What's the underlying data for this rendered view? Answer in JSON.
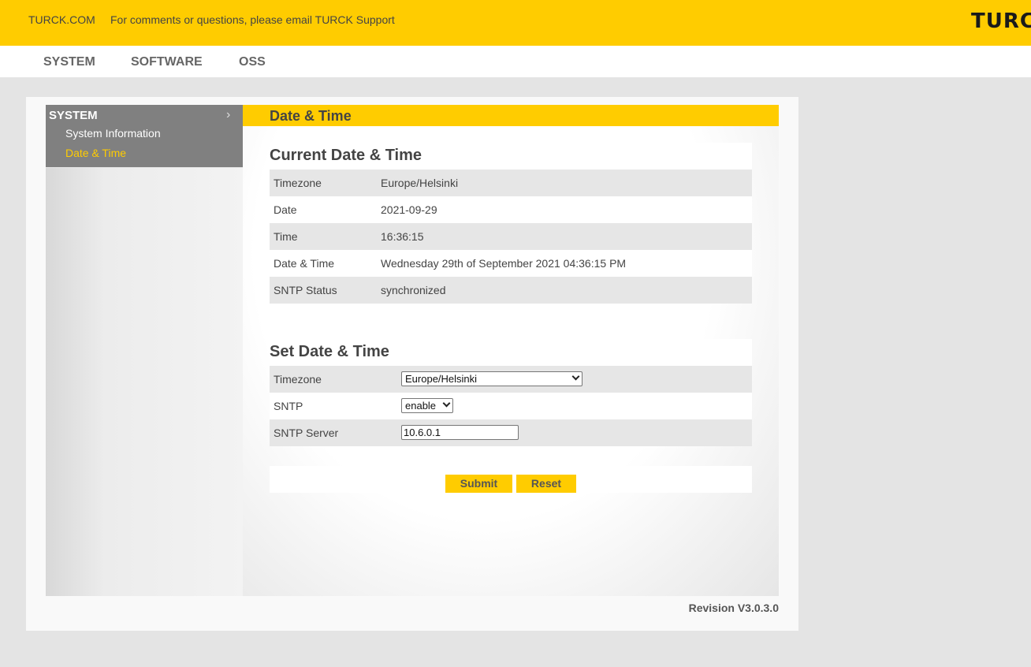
{
  "header": {
    "site_link": "TURCK.COM",
    "support_text": "For comments or questions, please email TURCK Support",
    "logo_text": "TURCK"
  },
  "nav": {
    "items": [
      "SYSTEM",
      "SOFTWARE",
      "OSS"
    ]
  },
  "sidebar": {
    "title": "SYSTEM",
    "chevron": "›",
    "items": [
      {
        "label": "System Information",
        "active": false
      },
      {
        "label": "Date & Time",
        "active": true
      }
    ]
  },
  "content": {
    "title": "Date & Time",
    "current": {
      "title": "Current Date & Time",
      "rows": [
        {
          "label": "Timezone",
          "value": "Europe/Helsinki"
        },
        {
          "label": "Date",
          "value": "2021-09-29"
        },
        {
          "label": "Time",
          "value": "16:36:15"
        },
        {
          "label": "Date & Time",
          "value": "Wednesday 29th of September 2021 04:36:15 PM"
        },
        {
          "label": "SNTP Status",
          "value": "synchronized"
        }
      ]
    },
    "set": {
      "title": "Set Date & Time",
      "timezone_label": "Timezone",
      "timezone_value": "Europe/Helsinki",
      "sntp_label": "SNTP",
      "sntp_value": "enable",
      "server_label": "SNTP Server",
      "server_value": "10.6.0.1"
    },
    "buttons": {
      "submit": "Submit",
      "reset": "Reset"
    }
  },
  "footer": {
    "revision": "Revision V3.0.3.0"
  },
  "colors": {
    "accent": "#ffcc00",
    "sidebar_head": "#808080",
    "row_alt": "#e6e6e6"
  }
}
